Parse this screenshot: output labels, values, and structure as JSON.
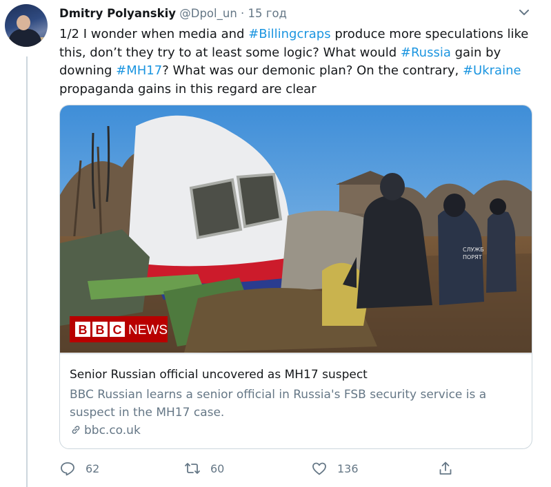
{
  "tweet": {
    "author_name": "Dmitry Polyanskiy",
    "handle": "@Dpol_un",
    "separator": "·",
    "time": "15 год",
    "text_segments": [
      {
        "text": "1/2 I wonder when media and ",
        "hashtag": false
      },
      {
        "text": "#Billingcraps",
        "hashtag": true
      },
      {
        "text": " produce more speculations like this, don’t they try to at least some logic? What would ",
        "hashtag": false
      },
      {
        "text": "#Russia",
        "hashtag": true
      },
      {
        "text": " gain by downing ",
        "hashtag": false
      },
      {
        "text": "#MH17",
        "hashtag": true
      },
      {
        "text": "? What was our demonic plan? On the contrary, ",
        "hashtag": false
      },
      {
        "text": "#Ukraine",
        "hashtag": true
      },
      {
        "text": " propaganda gains in this regard are clear",
        "hashtag": false
      }
    ]
  },
  "card": {
    "image_badge": {
      "letters": [
        "B",
        "B",
        "C"
      ],
      "word": "NEWS"
    },
    "vest_text": [
      "СЛУЖБ",
      "ПОРЯТ"
    ],
    "title": "Senior Russian official uncovered as MH17 suspect",
    "description": "BBC Russian learns a senior official in Russia's FSB security service is a suspect in the MH17 case.",
    "domain": "bbc.co.uk",
    "link_icon": "link-icon"
  },
  "actions": {
    "reply": {
      "icon": "reply-icon",
      "count": "62"
    },
    "retweet": {
      "icon": "retweet-icon",
      "count": "60"
    },
    "like": {
      "icon": "heart-icon",
      "count": "136"
    },
    "share": {
      "icon": "share-icon"
    }
  },
  "colors": {
    "hashtag": "#1b95e0",
    "secondary_text": "#657786",
    "border": "#ccd6dd",
    "bbc_red": "#b80000"
  }
}
